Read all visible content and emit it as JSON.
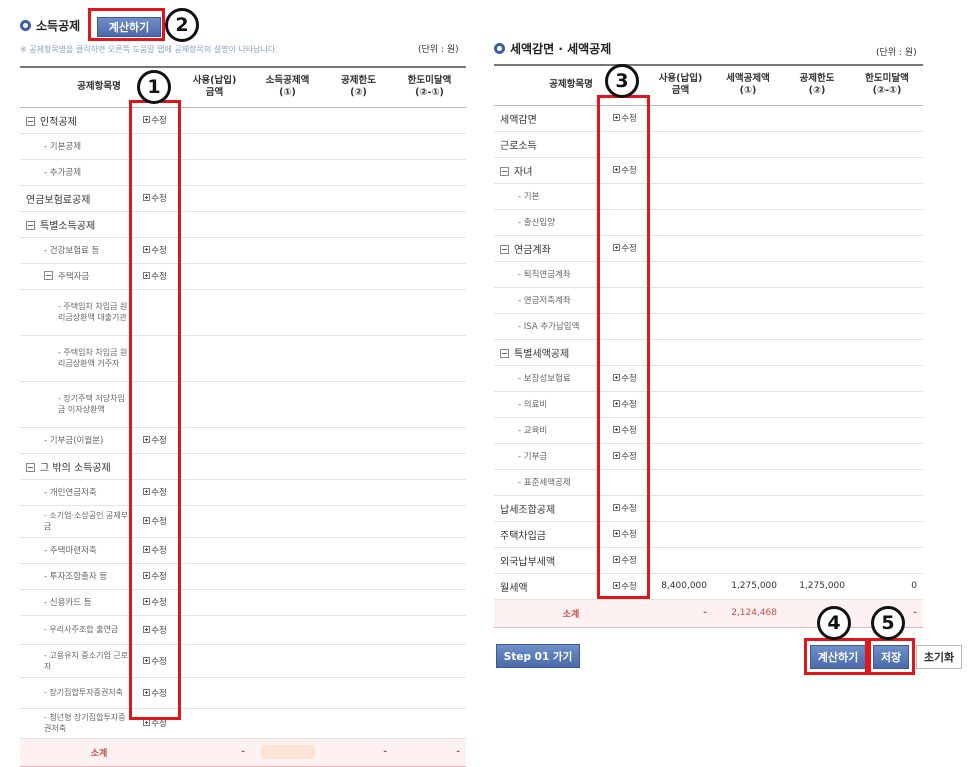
{
  "left": {
    "title": "소득공제",
    "calc_button": "계산하기",
    "note": "※ 공제항목명을 클릭하면 오른쪽 도움말 탭에 공제항목의 설명이 나타납니다.",
    "unit": "(단위 : 원)",
    "headers": {
      "item": "공제항목명",
      "amount1": "사용(납입)",
      "amount2": "금액",
      "deduct1": "소득공제액",
      "deduct2": "(①)",
      "limit1": "공제한도",
      "limit2": "(②)",
      "under1": "한도미달액",
      "under2": "(②-①)"
    },
    "rows": [
      {
        "label": "인적공제",
        "action": "수정"
      },
      {
        "label": "- 기본공제",
        "action": ""
      },
      {
        "label": "- 추가공제",
        "action": ""
      },
      {
        "label": "연금보험료공제",
        "action": "수정"
      },
      {
        "label": "특별소득공제",
        "action": ""
      },
      {
        "label": "- 건강보험료 등",
        "action": "수정"
      },
      {
        "label": "주택자금",
        "action": "수정"
      },
      {
        "label": "- 주택임차 차입금 원리금상환액 대출기관",
        "action": ""
      },
      {
        "label": "- 주택임차 차입금 원리금상환액 거주자",
        "action": ""
      },
      {
        "label": "- 장기주택 저당차입금 이자상환액",
        "action": ""
      },
      {
        "label": "- 기부금(이월분)",
        "action": "수정"
      },
      {
        "label": "그 밖의 소득공제",
        "action": ""
      },
      {
        "label": "- 개인연금저축",
        "action": "수정"
      },
      {
        "label": "- 소기업·소상공인 공제부금",
        "action": "수정"
      },
      {
        "label": "- 주택마련저축",
        "action": "수정"
      },
      {
        "label": "- 투자조합출자 등",
        "action": "수정"
      },
      {
        "label": "- 신용카드 등",
        "action": "수정"
      },
      {
        "label": "- 우리사주조합 출연금",
        "action": "수정"
      },
      {
        "label": "- 고용유지 중소기업 근로자",
        "action": "수정"
      },
      {
        "label": "- 장기집합투자증권저축",
        "action": "수정"
      },
      {
        "label": "- 청년형 장기집합투자증권저축",
        "action": "수정"
      }
    ],
    "total": {
      "label": "소계",
      "c1": "-",
      "c3": "-",
      "c4": "-"
    }
  },
  "right": {
    "title": "세액감면 · 세액공제",
    "unit": "(단위 : 원)",
    "headers": {
      "item": "공제항목명",
      "amount1": "사용(납입)",
      "amount2": "금액",
      "credit1": "세액공제액",
      "credit2": "(①)",
      "limit1": "공제한도",
      "limit2": "(②)",
      "under1": "한도미달액",
      "under2": "(②-①)"
    },
    "rows": [
      {
        "label": "세액감면",
        "action": "수정",
        "amount": "",
        "credit": "",
        "limit": "",
        "under": ""
      },
      {
        "label": "근로소득",
        "action": "",
        "amount": "",
        "credit": "",
        "limit": "",
        "under": ""
      },
      {
        "label": "자녀",
        "action": "수정",
        "amount": "",
        "credit": "",
        "limit": "",
        "under": ""
      },
      {
        "label": "- 기본",
        "action": "",
        "amount": "",
        "credit": "",
        "limit": "",
        "under": ""
      },
      {
        "label": "- 출산입양",
        "action": "",
        "amount": "",
        "credit": "",
        "limit": "",
        "under": ""
      },
      {
        "label": "연금계좌",
        "action": "수정",
        "amount": "",
        "credit": "",
        "limit": "",
        "under": ""
      },
      {
        "label": "- 퇴직연금계좌",
        "action": "",
        "amount": "",
        "credit": "",
        "limit": "",
        "under": ""
      },
      {
        "label": "- 연금저축계좌",
        "action": "",
        "amount": "",
        "credit": "",
        "limit": "",
        "under": ""
      },
      {
        "label": "- ISA 추가납입액",
        "action": "",
        "amount": "",
        "credit": "",
        "limit": "",
        "under": ""
      },
      {
        "label": "특별세액공제",
        "action": "",
        "amount": "",
        "credit": "",
        "limit": "",
        "under": ""
      },
      {
        "label": "- 보장성보험료",
        "action": "수정",
        "amount": "",
        "credit": "",
        "limit": "",
        "under": ""
      },
      {
        "label": "- 의료비",
        "action": "수정",
        "amount": "",
        "credit": "",
        "limit": "",
        "under": ""
      },
      {
        "label": "- 교육비",
        "action": "수정",
        "amount": "",
        "credit": "",
        "limit": "",
        "under": ""
      },
      {
        "label": "- 기부금",
        "action": "수정",
        "amount": "",
        "credit": "",
        "limit": "",
        "under": ""
      },
      {
        "label": "- 표준세액공제",
        "action": "",
        "amount": "",
        "credit": "",
        "limit": "",
        "under": ""
      },
      {
        "label": "납세조합공제",
        "action": "수정",
        "amount": "",
        "credit": "",
        "limit": "",
        "under": ""
      },
      {
        "label": "주택차입금",
        "action": "수정",
        "amount": "",
        "credit": "",
        "limit": "",
        "under": ""
      },
      {
        "label": "외국납부세액",
        "action": "수정",
        "amount": "",
        "credit": "",
        "limit": "",
        "under": ""
      },
      {
        "label": "월세액",
        "action": "수정",
        "amount": "8,400,000",
        "credit": "1,275,000",
        "limit": "1,275,000",
        "under": "0"
      }
    ],
    "total": {
      "label": "소계",
      "c1": "-",
      "c2": "2,124,468",
      "c3": "",
      "c4": "-"
    }
  },
  "buttons": {
    "step01": "Step 01 가기",
    "calc": "계산하기",
    "save": "저장",
    "reset": "초기화"
  },
  "callouts": [
    "1",
    "2",
    "3",
    "4",
    "5"
  ]
}
